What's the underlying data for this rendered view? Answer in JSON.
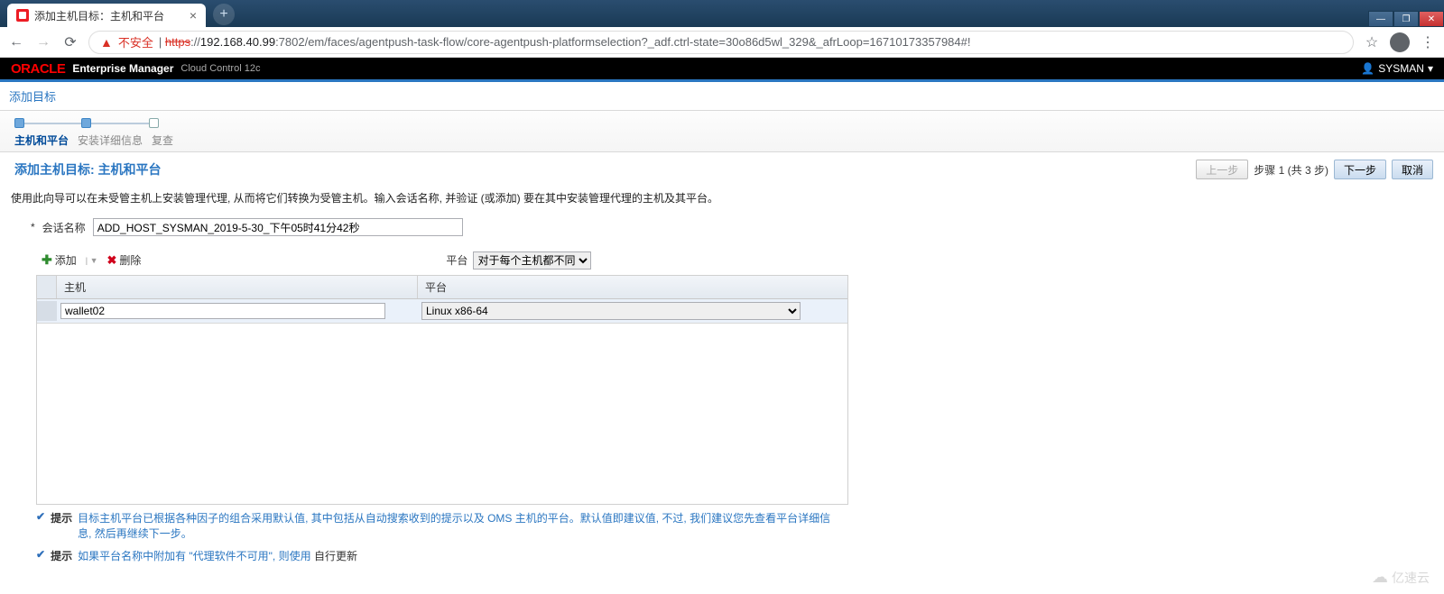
{
  "browser": {
    "tab_title": "添加主机目标：主机和平台",
    "insecure_label": "不安全",
    "url_https": "https",
    "url_sep": "://",
    "url_ip": "192.168.40.99",
    "url_rest": ":7802/em/faces/agentpush-task-flow/core-agentpush-platformselection?_adf.ctrl-state=30o86d5wl_329&_afrLoop=16710173357984#!"
  },
  "header": {
    "logo": "ORACLE",
    "product": "Enterprise Manager",
    "edition": "Cloud Control 12c",
    "user": "SYSMAN"
  },
  "page": {
    "breadcrumb": "添加目标",
    "train_steps": {
      "s1": "主机和平台",
      "s2": "安装详细信息",
      "s3": "复查"
    },
    "section_title": "添加主机目标: 主机和平台",
    "buttons": {
      "prev": "上一步",
      "next": "下一步",
      "cancel": "取消"
    },
    "step_of": "步骤 1 (共 3 步)",
    "instruction": "使用此向导可以在未受管主机上安装管理代理, 从而将它们转换为受管主机。输入会话名称, 并验证 (或添加) 要在其中安装管理代理的主机及其平台。",
    "session_label": "会话名称",
    "session_value": "ADD_HOST_SYSMAN_2019-5-30_下午05时41分42秒",
    "toolbar": {
      "add": "添加",
      "remove": "删除",
      "platform_label": "平台"
    },
    "platform_filter_value": "对于每个主机都不同",
    "grid": {
      "col_host": "主机",
      "col_plat": "平台",
      "rows": [
        {
          "host": "wallet02",
          "platform": "Linux x86-64"
        }
      ]
    },
    "hints": {
      "label": "提示",
      "h1": "目标主机平台已根据各种因子的组合采用默认值, 其中包括从自动搜索收到的提示以及 OMS 主机的平台。默认值即建议值, 不过, 我们建议您先查看平台详细信息, 然后再继续下一步。",
      "h2_pre": "如果平台名称中附加有 \"代理软件不可用\", 则使用 ",
      "h2_link": "自行更新"
    }
  },
  "watermark": "亿速云"
}
